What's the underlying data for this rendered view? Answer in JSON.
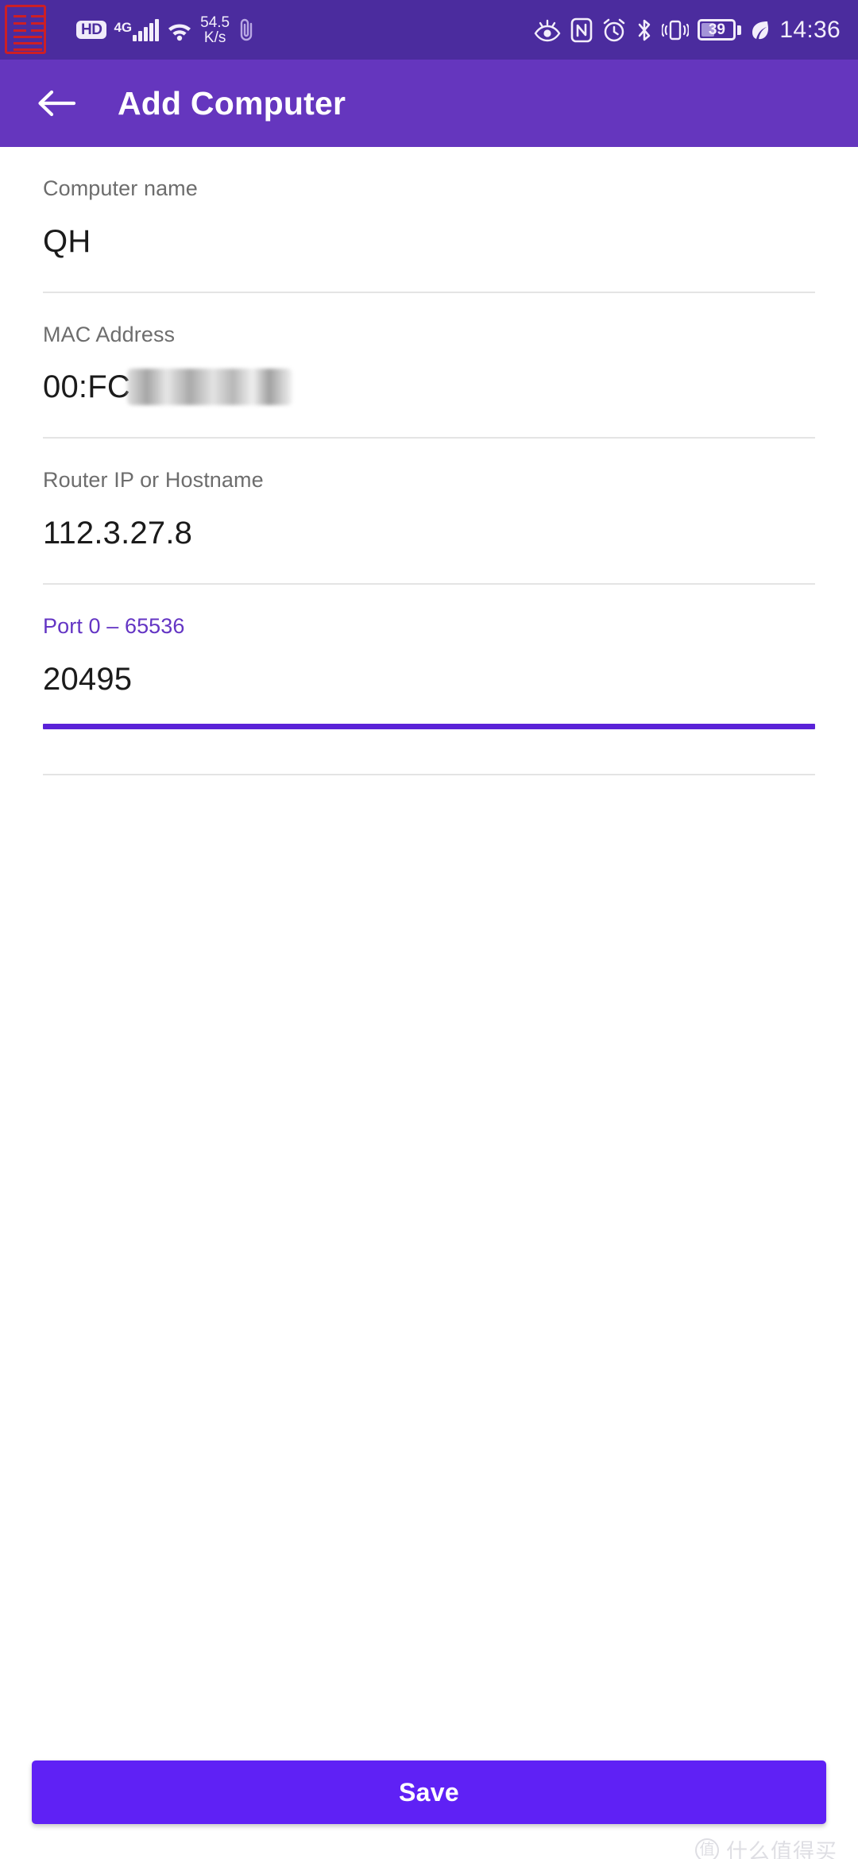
{
  "status_bar": {
    "hd_badge": "HD",
    "network_type": "4G",
    "network_speed_value": "54.5",
    "network_speed_unit": "K/s",
    "attachment_icon": "paperclip-icon",
    "eye_comfort_icon": "eye-comfort-icon",
    "nfc_icon": "nfc-icon",
    "alarm_icon": "alarm-clock-icon",
    "bluetooth_icon": "bluetooth-icon",
    "vibrate_icon": "vibrate-icon",
    "battery_percent": "39",
    "power_saver_icon": "leaf-icon",
    "time": "14:36",
    "background_color": "#4b2c9e",
    "watermark_stamp": "red-seal-stamp"
  },
  "app_bar": {
    "back_icon": "back-arrow-icon",
    "title": "Add Computer",
    "background_color": "#6536be"
  },
  "form": {
    "fields": [
      {
        "label": "Computer name",
        "value": "QH",
        "focused": false,
        "redacted": false
      },
      {
        "label": "MAC Address",
        "value": "00:FC",
        "focused": false,
        "redacted": true
      },
      {
        "label": "Router IP or Hostname",
        "value": "112.3.27.8",
        "focused": false,
        "redacted": false
      },
      {
        "label": "Port 0 – 65536",
        "value": "20495",
        "focused": true,
        "redacted": false
      }
    ],
    "focus_color": "#6435c4",
    "underline_color": "#5a22d8",
    "divider_color": "#e4e4e4"
  },
  "footer": {
    "save_label": "Save",
    "save_color": "#5f21f5"
  },
  "watermark": {
    "badge": "值",
    "text": "什么值得买"
  }
}
